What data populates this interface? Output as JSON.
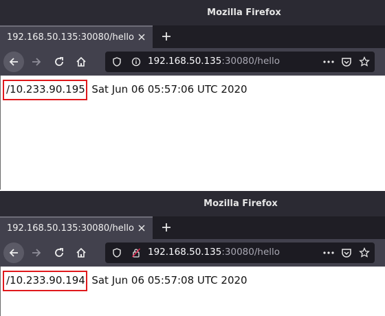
{
  "windows": [
    {
      "title": "Mozilla Firefox",
      "tab": {
        "title": "192.168.50.135:30080/hello"
      },
      "url": {
        "host": "192.168.50.135",
        "rest": ":30080/hello",
        "insecure": false
      },
      "page": {
        "ip": "/10.233.90.195,",
        "rest": " Sat Jun 06 05:57:06 UTC 2020"
      }
    },
    {
      "title": "Mozilla Firefox",
      "tab": {
        "title": "192.168.50.135:30080/hello"
      },
      "url": {
        "host": "192.168.50.135",
        "rest": ":30080/hello",
        "insecure": true
      },
      "page": {
        "ip": "/10.233.90.194,",
        "rest": " Sat Jun 06 05:57:08 UTC 2020"
      }
    }
  ],
  "icons": {
    "back": "back-arrow-icon",
    "forward": "forward-arrow-icon",
    "reload": "reload-icon",
    "home": "home-icon",
    "tracking": "shield-icon",
    "info": "info-icon",
    "insecure": "insecure-lock-icon",
    "more": "more-icon",
    "pocket": "pocket-icon",
    "bookmark": "bookmark-star-icon",
    "close": "close-icon",
    "new_tab": "plus-icon"
  },
  "colors": {
    "highlight": "#e0181b",
    "chrome_dark": "#2b2a33",
    "toolbar": "#42414d"
  }
}
